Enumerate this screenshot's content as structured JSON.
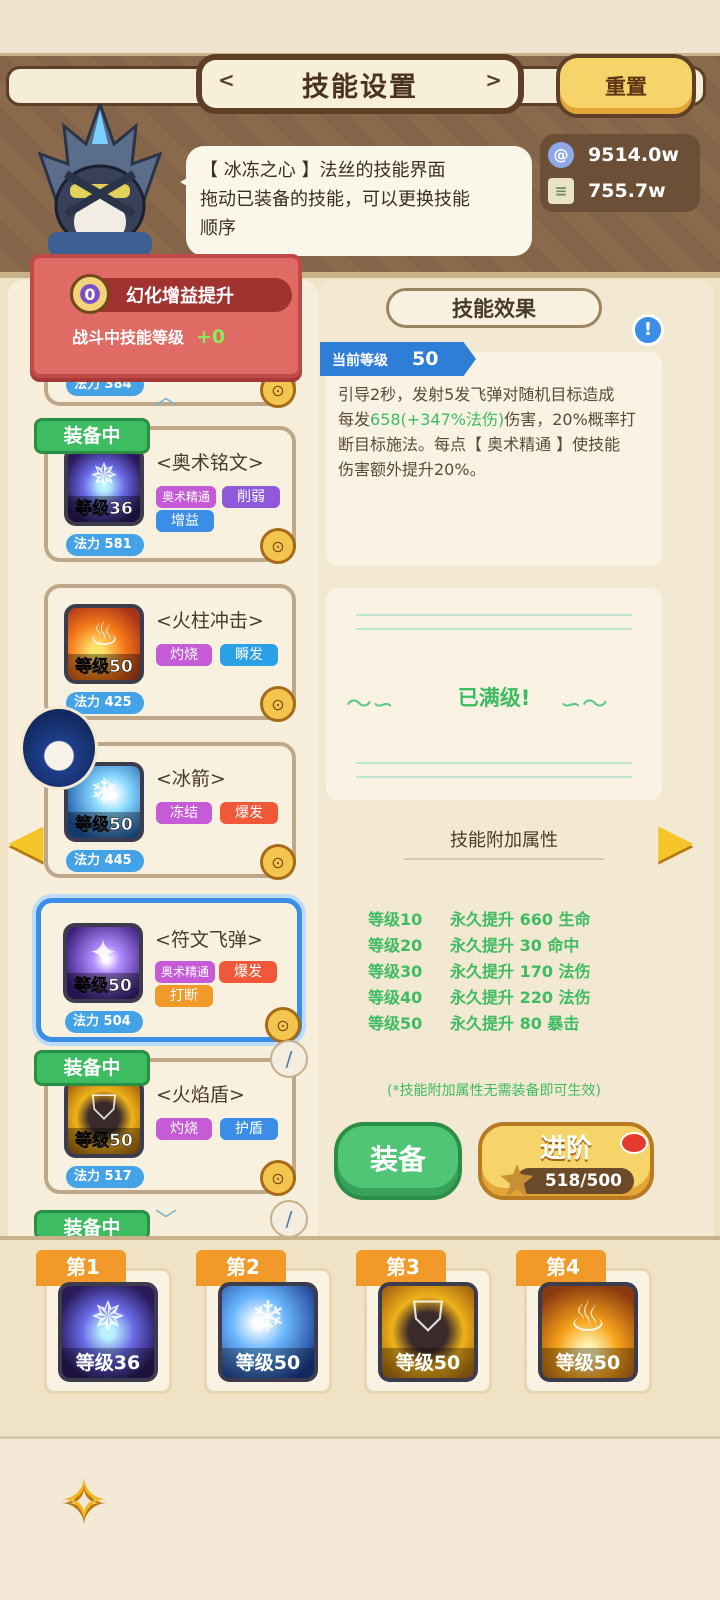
{
  "title": "技能设置",
  "reset_label": "重置",
  "speech": {
    "line1": "【 冰冻之心 】法丝的技能界面",
    "line2": "拖动已装备的技能，可以更换技能",
    "line3": "顺序"
  },
  "currency": {
    "gem": "9514.0w",
    "scroll": "755.7w"
  },
  "buff": {
    "level": "0",
    "title": "幻化增益提升",
    "subtitle": "战斗中技能等级",
    "bonus": "+0"
  },
  "partial_card": {
    "mana": "法力 384"
  },
  "skills": [
    {
      "name": "<奥术铭文>",
      "level": "等级36",
      "mana": "法力 581",
      "tags": [
        "奥术精通",
        "削弱",
        "增益"
      ],
      "equipped": "装备中"
    },
    {
      "name": "<火柱冲击>",
      "level": "等级50",
      "mana": "法力 425",
      "tags": [
        "灼烧",
        "瞬发"
      ]
    },
    {
      "name": "<冰箭>",
      "level": "等级50",
      "mana": "法力 445",
      "tags": [
        "冻结",
        "爆发"
      ]
    },
    {
      "name": "<符文飞弹>",
      "level": "等级50",
      "mana": "法力 504",
      "tags": [
        "奥术精通",
        "爆发",
        "打断"
      ]
    },
    {
      "name": "<火焰盾>",
      "level": "等级50",
      "mana": "法力 517",
      "tags": [
        "灼烧",
        "护盾"
      ],
      "equipped": "装备中"
    }
  ],
  "next_equipped_label": "装备中",
  "effect": {
    "title": "技能效果",
    "current_level_label": "当前等级",
    "current_level": "50",
    "desc_1": "引导2秒，发射5发飞弹对随机目标造成",
    "desc_2a": "每发",
    "desc_2b": "658(+347%法伤)",
    "desc_2c": "伤害，20%概率打",
    "desc_3": "断目标施法。每点【 奥术精通 】使技能",
    "desc_4": "伤害额外提升20%。"
  },
  "maxed_label": "已满级!",
  "attributes": {
    "title": "技能附加属性",
    "rows": [
      {
        "level": "等级10",
        "text": "永久提升 660 生命"
      },
      {
        "level": "等级20",
        "text": "永久提升 30 命中"
      },
      {
        "level": "等级30",
        "text": "永久提升 170 法伤"
      },
      {
        "level": "等级40",
        "text": "永久提升 220 法伤"
      },
      {
        "level": "等级50",
        "text": "永久提升 80 暴击"
      }
    ],
    "note": "(*技能附加属性无需装备即可生效)"
  },
  "equip_label": "装备",
  "advance": {
    "label": "进阶",
    "progress": "518/500"
  },
  "slots": [
    {
      "badge": "第1",
      "level": "等级36"
    },
    {
      "badge": "第2",
      "level": "等级50"
    },
    {
      "badge": "第3",
      "level": "等级50"
    },
    {
      "badge": "第4",
      "level": "等级50"
    }
  ],
  "icons": {
    "gem": "swirl-gem-icon",
    "scroll": "scroll-icon",
    "lock": "lock-icon",
    "staff": "staff-icon",
    "info": "info-icon",
    "fish": "fish-bone-icon"
  }
}
